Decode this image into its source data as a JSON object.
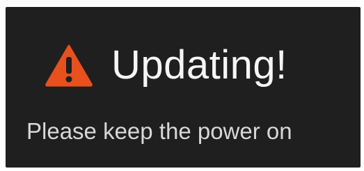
{
  "dialog": {
    "icon": "warning-triangle-icon",
    "icon_color": "#e8501e",
    "title": "Updating!",
    "message": "Please keep the power on",
    "background_color": "#1f1f1f",
    "text_color": "#f5f5f5"
  }
}
